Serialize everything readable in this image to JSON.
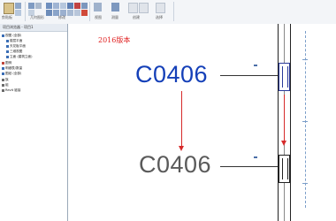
{
  "ribbon": {
    "groups": [
      {
        "label": "剪贴板"
      },
      {
        "label": "几何图形"
      },
      {
        "label": "修改"
      },
      {
        "label": "视图"
      },
      {
        "label": "测量"
      },
      {
        "label": "创建"
      },
      {
        "label": "选择"
      }
    ]
  },
  "browser": {
    "title": "项目浏览器 - 项目1",
    "items": [
      {
        "label": "视图 (全部)",
        "color": "#3a6db5"
      },
      {
        "label": "楼层平面",
        "color": "#3a6db5"
      },
      {
        "label": "天花板平面",
        "color": "#3a6db5"
      },
      {
        "label": "三维视图",
        "color": "#3a6db5"
      },
      {
        "label": "立面 (建筑立面)",
        "color": "#3a6db5"
      },
      {
        "label": "图例",
        "color": "#c0463b"
      },
      {
        "label": "明细表/数量",
        "color": "#3a6db5"
      },
      {
        "label": "图纸 (全部)",
        "color": "#3a6db5"
      },
      {
        "label": "族",
        "color": "#6b6b6b"
      },
      {
        "label": "组",
        "color": "#6b6b6b"
      },
      {
        "label": "Revit 链接",
        "color": "#6b6b6b"
      }
    ]
  },
  "canvas": {
    "year_note": "2016版本",
    "tag_new": "C0406",
    "tag_old": "C0406",
    "colors": {
      "new_tag": "#1540b8",
      "old_tag": "#5a5a5a",
      "arrow": "#d62a2a",
      "note": "#e02020"
    }
  }
}
